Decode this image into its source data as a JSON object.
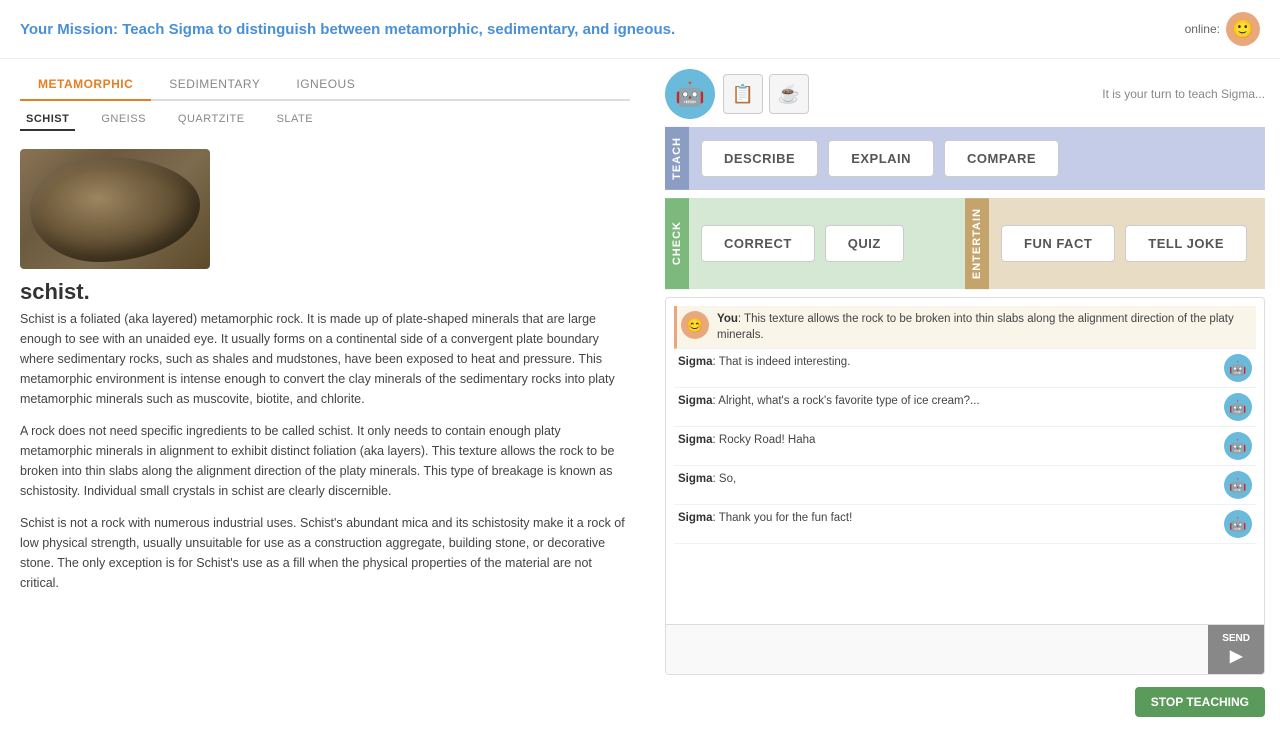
{
  "header": {
    "mission_prefix": "Your Mission:",
    "mission_text": " Teach Sigma to distinguish between metamorphic, sedimentary, and igneous.",
    "online_label": "online:"
  },
  "tabs": {
    "items": [
      {
        "label": "METAMORPHIC",
        "active": true
      },
      {
        "label": "SEDIMENTARY",
        "active": false
      },
      {
        "label": "IGNEOUS",
        "active": false
      }
    ]
  },
  "sub_tabs": {
    "items": [
      {
        "label": "SCHIST",
        "active": true
      },
      {
        "label": "GNEISS",
        "active": false
      },
      {
        "label": "QUARTZITE",
        "active": false
      },
      {
        "label": "SLATE",
        "active": false
      }
    ]
  },
  "rock": {
    "name": "schist.",
    "paragraphs": [
      "Schist is a foliated (aka layered) metamorphic rock. It is made up of plate-shaped minerals that are large enough to see with an unaided eye. It usually forms on a continental side of a convergent plate boundary where sedimentary rocks, such as shales and mudstones, have been exposed to heat and pressure. This metamorphic environment is intense enough to convert the clay minerals of the sedimentary rocks into platy metamorphic minerals such as muscovite, biotite, and chlorite.",
      "A rock does not need specific ingredients to be called schist. It only needs to contain enough platy metamorphic minerals in alignment to exhibit distinct foliation (aka layers). This texture allows the rock to be broken into thin slabs along the alignment direction of the platy minerals. This type of breakage is known as schistosity. Individual small crystals in schist are clearly discernible.",
      "Schist is not a rock with numerous industrial uses. Schist's abundant mica and its schistosity make it a rock of low physical strength, usually unsuitable for use as a construction aggregate, building stone, or decorative stone. The only exception is for Schist's use as a fill when the physical properties of the material are not critical."
    ]
  },
  "teach_buttons": [
    {
      "label": "DESCRIBE"
    },
    {
      "label": "EXPLAIN"
    },
    {
      "label": "COMPARE"
    }
  ],
  "check_buttons": [
    {
      "label": "CORRECT"
    },
    {
      "label": "QUIZ"
    }
  ],
  "entertain_buttons": [
    {
      "label": "FUN FACT"
    },
    {
      "label": "TELL JOKE"
    }
  ],
  "section_labels": {
    "teach": "TEACH",
    "check": "CHECK",
    "entertain": "ENTERTAIN"
  },
  "sigma_status": "It is your turn to teach Sigma...",
  "chat": {
    "messages": [
      {
        "sender": "You",
        "text": ": This texture allows the rock to be broken into thin slabs along the alignment direction of the platy minerals.",
        "type": "you"
      },
      {
        "sender": "Sigma",
        "text": ": That is indeed interesting.",
        "type": "sigma"
      },
      {
        "sender": "Sigma",
        "text": ": Alright, what's a rock's favorite type of ice cream?...",
        "type": "sigma"
      },
      {
        "sender": "Sigma",
        "text": ": Rocky Road! Haha",
        "type": "sigma"
      },
      {
        "sender": "Sigma",
        "text": ": So,",
        "type": "sigma"
      },
      {
        "sender": "Sigma",
        "text": ": Thank you for the fun fact!",
        "type": "sigma"
      }
    ],
    "input_placeholder": "",
    "send_label": "SEND"
  },
  "stop_button": {
    "label": "STOP TEACHING"
  }
}
